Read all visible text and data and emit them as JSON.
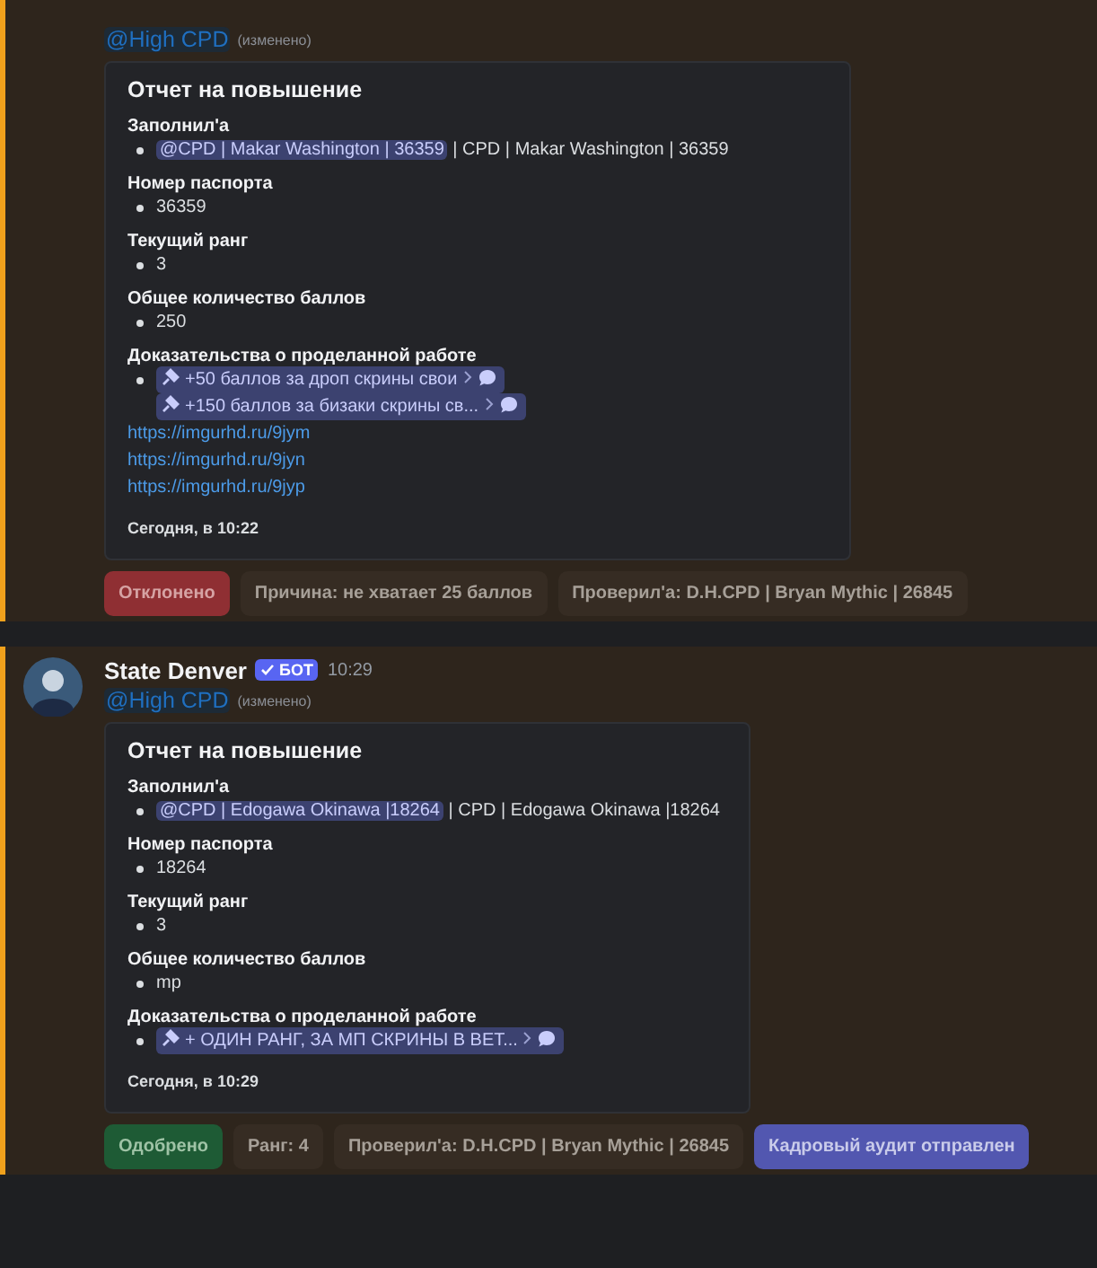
{
  "messages": [
    {
      "mention": "@High CPD",
      "edited": "(изменено)",
      "embed": {
        "title": "Отчет на повышение",
        "fields": [
          {
            "name": "Заполнил'а",
            "lines": [
              {
                "bullet": true,
                "parts": [
                  {
                    "kind": "mention",
                    "text": "@CPD | Makar Washington | 36359"
                  },
                  {
                    "kind": "text",
                    "text": " | CPD | Makar Washington | 36359"
                  }
                ]
              }
            ]
          },
          {
            "name": "Номер паспорта",
            "lines": [
              {
                "bullet": true,
                "parts": [
                  {
                    "kind": "text",
                    "text": "36359"
                  }
                ]
              }
            ]
          },
          {
            "name": "Текущий ранг",
            "lines": [
              {
                "bullet": true,
                "parts": [
                  {
                    "kind": "text",
                    "text": "3"
                  }
                ]
              }
            ]
          },
          {
            "name": "Общее количество баллов",
            "lines": [
              {
                "bullet": true,
                "parts": [
                  {
                    "kind": "text",
                    "text": "250"
                  }
                ]
              }
            ]
          },
          {
            "name": "Доказательства о проделанной работе",
            "lines": [
              {
                "bullet": true,
                "parts": [
                  {
                    "kind": "thread",
                    "text": "+50 баллов за дроп скрины свои"
                  },
                  {
                    "kind": "thread",
                    "text": "+150 баллов за бизаки скрины св..."
                  }
                ]
              },
              {
                "bullet": false,
                "parts": [
                  {
                    "kind": "link",
                    "text": "https://imgurhd.ru/9jym"
                  }
                ]
              },
              {
                "bullet": false,
                "parts": [
                  {
                    "kind": "link",
                    "text": "https://imgurhd.ru/9jyn"
                  }
                ]
              },
              {
                "bullet": false,
                "parts": [
                  {
                    "kind": "link",
                    "text": "https://imgurhd.ru/9jyp"
                  }
                ]
              }
            ]
          }
        ],
        "footer": "Сегодня, в 10:22"
      },
      "buttons": [
        {
          "label": "Отклонено",
          "kind": "danger"
        },
        {
          "label": "Причина: не хватает 25 баллов",
          "kind": "secondary"
        },
        {
          "label": "Проверил'а: D.H.CPD | Bryan Mythic | 26845",
          "kind": "secondary"
        }
      ]
    },
    {
      "header": {
        "author": "State Denver",
        "badge": "БОТ",
        "time": "10:29"
      },
      "mention": "@High CPD",
      "edited": "(изменено)",
      "embed": {
        "title": "Отчет на повышение",
        "fields": [
          {
            "name": "Заполнил'а",
            "lines": [
              {
                "bullet": true,
                "parts": [
                  {
                    "kind": "mention",
                    "text": "@CPD | Edogawa Okinawa |18264"
                  },
                  {
                    "kind": "text",
                    "text": " | CPD | Edogawa Okinawa |18264"
                  }
                ]
              }
            ]
          },
          {
            "name": "Номер паспорта",
            "lines": [
              {
                "bullet": true,
                "parts": [
                  {
                    "kind": "text",
                    "text": "18264"
                  }
                ]
              }
            ]
          },
          {
            "name": "Текущий ранг",
            "lines": [
              {
                "bullet": true,
                "parts": [
                  {
                    "kind": "text",
                    "text": "3"
                  }
                ]
              }
            ]
          },
          {
            "name": "Общее количество баллов",
            "lines": [
              {
                "bullet": true,
                "parts": [
                  {
                    "kind": "text",
                    "text": "mp"
                  }
                ]
              }
            ]
          },
          {
            "name": "Доказательства о проделанной работе",
            "lines": [
              {
                "bullet": true,
                "parts": [
                  {
                    "kind": "thread",
                    "text": "+ ОДИН РАНГ, ЗА МП СКРИНЫ В ВЕТ..."
                  }
                ]
              }
            ]
          }
        ],
        "footer": "Сегодня, в 10:29"
      },
      "buttons": [
        {
          "label": "Одобрено",
          "kind": "success"
        },
        {
          "label": "Ранг: 4",
          "kind": "secondary"
        },
        {
          "label": "Проверил'а: D.H.CPD | Bryan Mythic | 26845",
          "kind": "secondary"
        },
        {
          "label": "Кадровый аудит отправлен",
          "kind": "primary"
        }
      ]
    }
  ]
}
